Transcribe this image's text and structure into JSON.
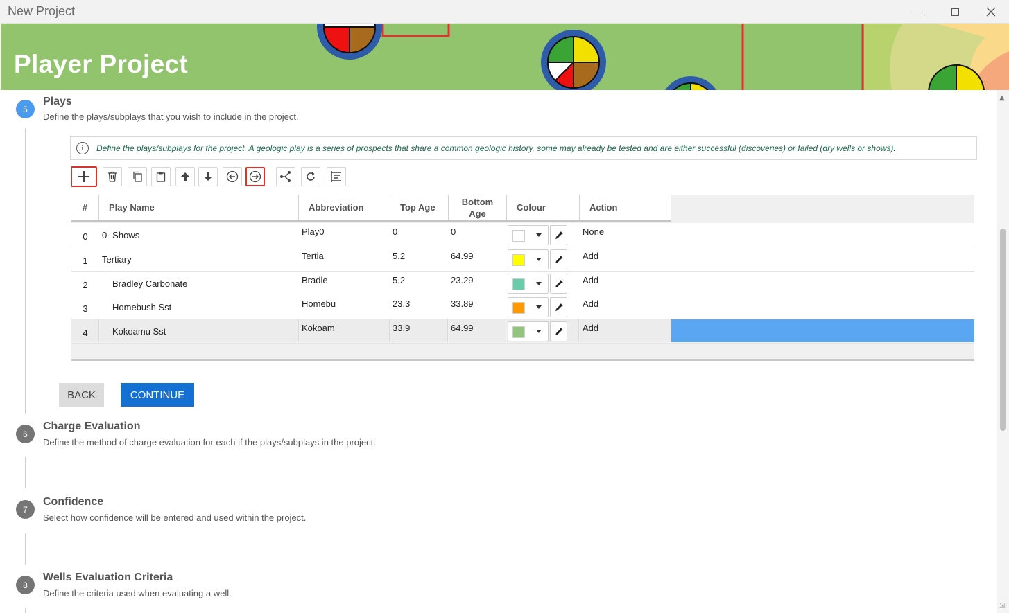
{
  "window": {
    "title": "New Project"
  },
  "banner": {
    "title": "Player Project"
  },
  "steps": [
    {
      "number": "5",
      "title": "Plays",
      "description": "Define the plays/subplays that you wish to include in the project."
    },
    {
      "number": "6",
      "title": "Charge Evaluation",
      "description": "Define the method of charge evaluation for each if the plays/subplays in the project."
    },
    {
      "number": "7",
      "title": "Confidence",
      "description": "Select how confidence will be entered and used within the project."
    },
    {
      "number": "8",
      "title": "Wells Evaluation Criteria",
      "description": "Define the criteria used when evaluating a well."
    }
  ],
  "info": {
    "icon": "info-circle-icon",
    "text": "Define the plays/subplays for the project. A geologic play is a series of prospects that share a common geologic history, some may already be tested and are either successful (discoveries) or failed (dry wells or shows)."
  },
  "toolbar": [
    {
      "name": "add-icon",
      "highlighted": true
    },
    {
      "name": "delete-icon"
    },
    {
      "name": "copy-icon"
    },
    {
      "name": "paste-icon"
    },
    {
      "name": "move-up-icon"
    },
    {
      "name": "move-down-icon"
    },
    {
      "name": "outdent-icon"
    },
    {
      "name": "indent-icon",
      "highlighted": true
    },
    {
      "name": "split-icon"
    },
    {
      "name": "refresh-icon"
    },
    {
      "name": "hierarchy-icon"
    }
  ],
  "table": {
    "columns": {
      "num": "#",
      "name": "Play Name",
      "abbr": "Abbreviation",
      "top": "Top Age",
      "bottom": "Bottom Age",
      "colour": "Colour",
      "action": "Action"
    },
    "rows": [
      {
        "num": "0",
        "name": "0- Shows",
        "indent": false,
        "abbr": "Play0",
        "top": "0",
        "bottom": "0",
        "colour": "#ffffff",
        "action": "None"
      },
      {
        "num": "1",
        "name": "Tertiary",
        "indent": false,
        "abbr": "Tertia",
        "top": "5.2",
        "bottom": "64.99",
        "colour": "#ffff00",
        "action": "Add"
      },
      {
        "num": "2",
        "name": "Bradley Carbonate",
        "indent": true,
        "abbr": "Bradle",
        "top": "5.2",
        "bottom": "23.29",
        "colour": "#66ccaa",
        "action": "Add"
      },
      {
        "num": "3",
        "name": "Homebush Sst",
        "indent": true,
        "abbr": "Homebu",
        "top": "23.3",
        "bottom": "33.89",
        "colour": "#ff9900",
        "action": "Add"
      },
      {
        "num": "4",
        "name": "Kokoamu Sst",
        "indent": true,
        "abbr": "Kokoam",
        "top": "33.9",
        "bottom": "64.99",
        "colour": "#93c47d",
        "action": "Add",
        "selected": true
      }
    ]
  },
  "buttons": {
    "back": "BACK",
    "continue": "CONTINUE"
  },
  "colors": {
    "accent": "#1470d3",
    "active_step": "#4a9bf0",
    "selection": "#5aa6f2",
    "highlight": "#d9342b"
  }
}
